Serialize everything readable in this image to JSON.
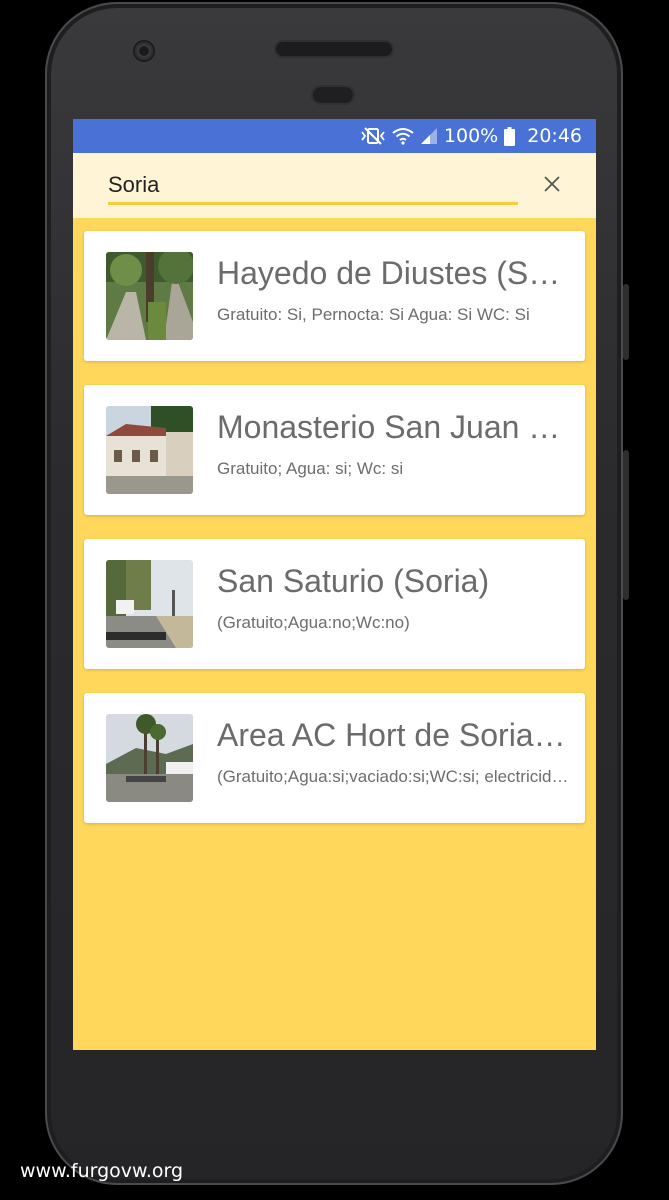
{
  "statusbar": {
    "battery": "100%",
    "time": "20:46",
    "icons": [
      "vibrate-mute-icon",
      "wifi-icon",
      "signal-icon",
      "battery-icon"
    ]
  },
  "search": {
    "value": "Soria",
    "clear_icon": "close-icon"
  },
  "results": [
    {
      "title": "Hayedo de Diustes (Soria)",
      "subtitle": "Gratuito: Si, Pernocta: Si Agua: Si WC: Si",
      "thumbnail": "forest-road-photo"
    },
    {
      "title": "Monasterio San Juan de Duero",
      "subtitle": "Gratuito; Agua: si; Wc: si",
      "thumbnail": "monastery-building-photo"
    },
    {
      "title": "San Saturio (Soria)",
      "subtitle": "(Gratuito;Agua:no;Wc:no)",
      "thumbnail": "riverside-parking-photo"
    },
    {
      "title": " Area AC Hort de Soriano",
      "subtitle": "(Gratuito;Agua:si;vaciado:si;WC:si; electricidad)",
      "thumbnail": "palm-area-photo"
    }
  ],
  "watermark": "www.furgovw.org",
  "colors": {
    "statusbar": "#4a72d6",
    "background": "#ffd75a",
    "search_bg": "#fff5d6",
    "search_underline": "#f5cc3a"
  }
}
